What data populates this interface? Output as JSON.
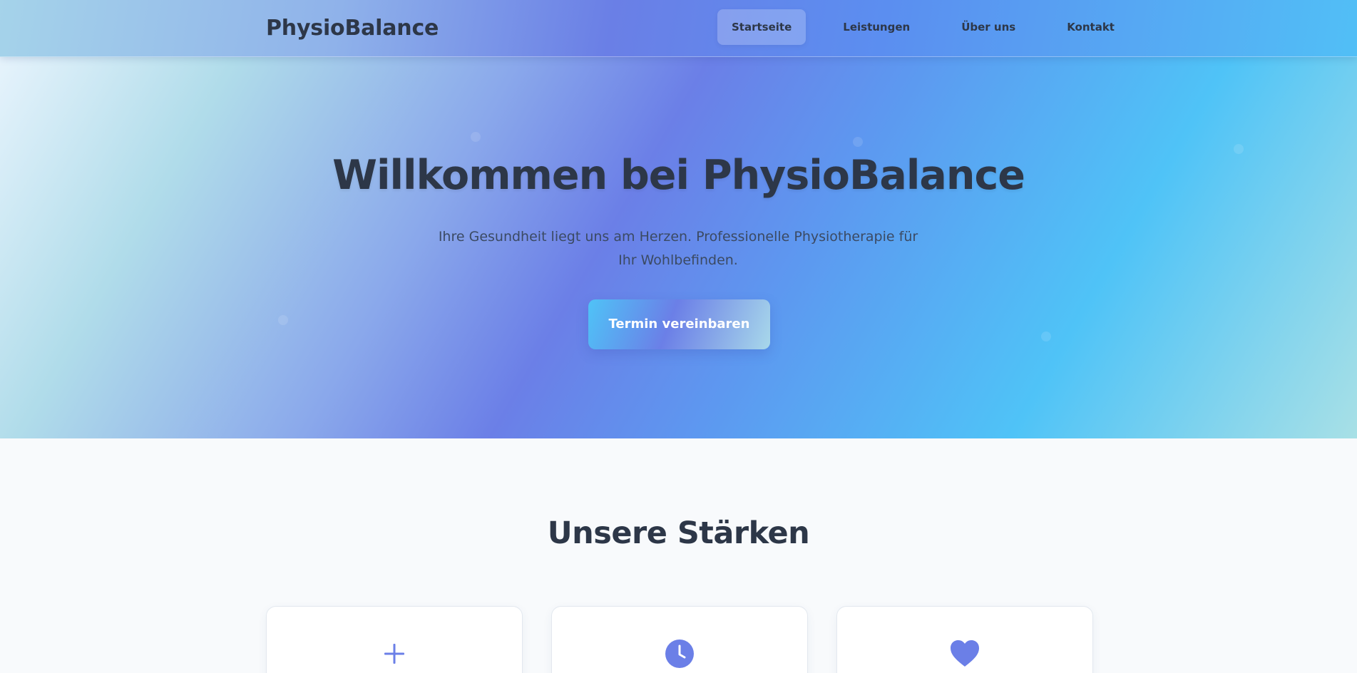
{
  "header": {
    "logo": "PhysioBalance",
    "nav": [
      {
        "label": "Startseite",
        "active": true
      },
      {
        "label": "Leistungen",
        "active": false
      },
      {
        "label": "Über uns",
        "active": false
      },
      {
        "label": "Kontakt",
        "active": false
      }
    ]
  },
  "hero": {
    "title": "Willkommen bei PhysioBalance",
    "subtitle": "Ihre Gesundheit liegt uns am Herzen. Professionelle Physiotherapie für Ihr Wohlbefinden.",
    "cta_label": "Termin vereinbaren"
  },
  "strengths": {
    "title": "Unsere Stärken",
    "cards": [
      {
        "icon": "plus-icon"
      },
      {
        "icon": "clock-icon"
      },
      {
        "icon": "heart-icon"
      }
    ]
  },
  "colors": {
    "text_dark": "#2d3748",
    "accent_purple": "#6b7fe7",
    "accent_blue": "#4fc3f7",
    "accent_light": "#a8d8ea",
    "section_bg": "#f8fafc",
    "card_bg": "#ffffff"
  }
}
